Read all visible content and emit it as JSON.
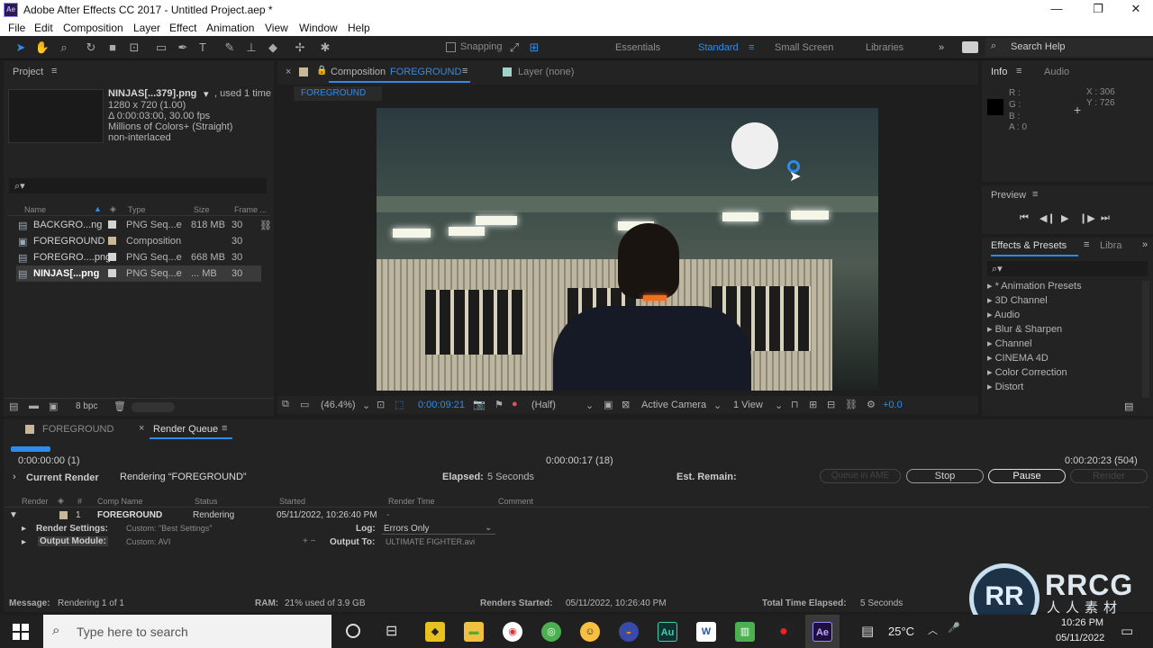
{
  "window": {
    "title": "Adobe After Effects CC 2017 - Untitled Project.aep *",
    "app_icon": "Ae"
  },
  "menu": [
    "File",
    "Edit",
    "Composition",
    "Layer",
    "Effect",
    "Animation",
    "View",
    "Window",
    "Help"
  ],
  "toolbar": {
    "snapping": "Snapping",
    "workspaces": [
      "Essentials",
      "Standard",
      "Small Screen",
      "Libraries"
    ],
    "active_workspace": "Standard",
    "search_help": "Search Help"
  },
  "project": {
    "panel_title": "Project",
    "selected_name": "NINJAS[...379].png",
    "used": ", used 1 time",
    "info_lines": [
      "1280 x 720 (1.00)",
      "Δ 0:00:03:00, 30.00 fps",
      "Millions of Colors+ (Straight)",
      "non-interlaced"
    ],
    "columns": [
      "Name",
      "Type",
      "Size",
      "Frame ..."
    ],
    "items": [
      {
        "name": "BACKGRO...ng",
        "type": "PNG Seq...e",
        "size": "818 MB",
        "frame": "30",
        "swatch": "#d4d4d4"
      },
      {
        "name": "FOREGROUND",
        "type": "Composition",
        "size": "",
        "frame": "30",
        "swatch": "#c8b89a"
      },
      {
        "name": "FOREGRO....png",
        "type": "PNG Seq...e",
        "size": "668 MB",
        "frame": "30",
        "swatch": "#d4d4d4"
      },
      {
        "name": "NINJAS[...png",
        "type": "PNG Seq...e",
        "size": "... MB",
        "frame": "30",
        "swatch": "#d4d4d4"
      }
    ],
    "bpc": "8 bpc"
  },
  "composition": {
    "tab_prefix": "Composition",
    "tab_name": "FOREGROUND",
    "layer_tab": "Layer (none)",
    "breadcrumb": "FOREGROUND",
    "zoom": "(46.4%)",
    "timecode": "0:00:09:21",
    "resolution": "(Half)",
    "camera": "Active Camera",
    "views": "1 View",
    "exposure": "+0.0"
  },
  "info": {
    "tab": "Info",
    "audio_tab": "Audio",
    "labels": [
      "R :",
      "G :",
      "B :",
      "A : 0"
    ],
    "x": "X : 306",
    "y": "Y : 726"
  },
  "preview": {
    "title": "Preview"
  },
  "effects": {
    "title": "Effects & Presets",
    "libra_tab": "Libra",
    "items": [
      "* Animation Presets",
      "3D Channel",
      "Audio",
      "Blur & Sharpen",
      "Channel",
      "CINEMA 4D",
      "Color Correction",
      "Distort"
    ]
  },
  "timeline": {
    "tab_comp": "FOREGROUND",
    "tab_render": "Render Queue"
  },
  "render": {
    "progress": 0.035,
    "start_time": "0:00:00:00 (1)",
    "mid_time": "0:00:00:17 (18)",
    "end_time": "0:00:20:23 (504)",
    "current_render_label": "Current Render",
    "rendering_text": "Rendering “FOREGROUND”",
    "elapsed_label": "Elapsed:",
    "elapsed_value": "5 Seconds",
    "remain_label": "Est. Remain:",
    "queue_ame": "Queue in AME",
    "stop": "Stop",
    "pause": "Pause",
    "render_btn": "Render",
    "columns": [
      "Render",
      "#",
      "Comp Name",
      "Status",
      "Started",
      "Render Time",
      "Comment"
    ],
    "item": {
      "num": "1",
      "comp": "FOREGROUND",
      "status": "Rendering",
      "started": "05/11/2022, 10:26:40 PM"
    },
    "settings_label": "Render Settings:",
    "settings_value": "Custom: \"Best Settings\"",
    "log_label": "Log:",
    "log_value": "Errors Only",
    "output_module_label": "Output Module:",
    "output_module_value": "Custom: AVI",
    "output_to_label": "Output To:",
    "output_to_value": "ULTIMATE FIGHTER.avi"
  },
  "status": {
    "message_label": "Message:",
    "message_value": "Rendering 1 of 1",
    "ram_label": "RAM:",
    "ram_value": "21% used of 3.9 GB",
    "started_label": "Renders Started:",
    "started_value": "05/11/2022, 10:26:40 PM",
    "total_label": "Total Time Elapsed:",
    "total_value": "5 Seconds"
  },
  "taskbar": {
    "search_placeholder": "Type here to search",
    "temperature": "25°C",
    "time": "10:26 PM",
    "date": "05/11/2022"
  },
  "watermark": {
    "line1": "RRCG",
    "line2": "人人素材"
  }
}
